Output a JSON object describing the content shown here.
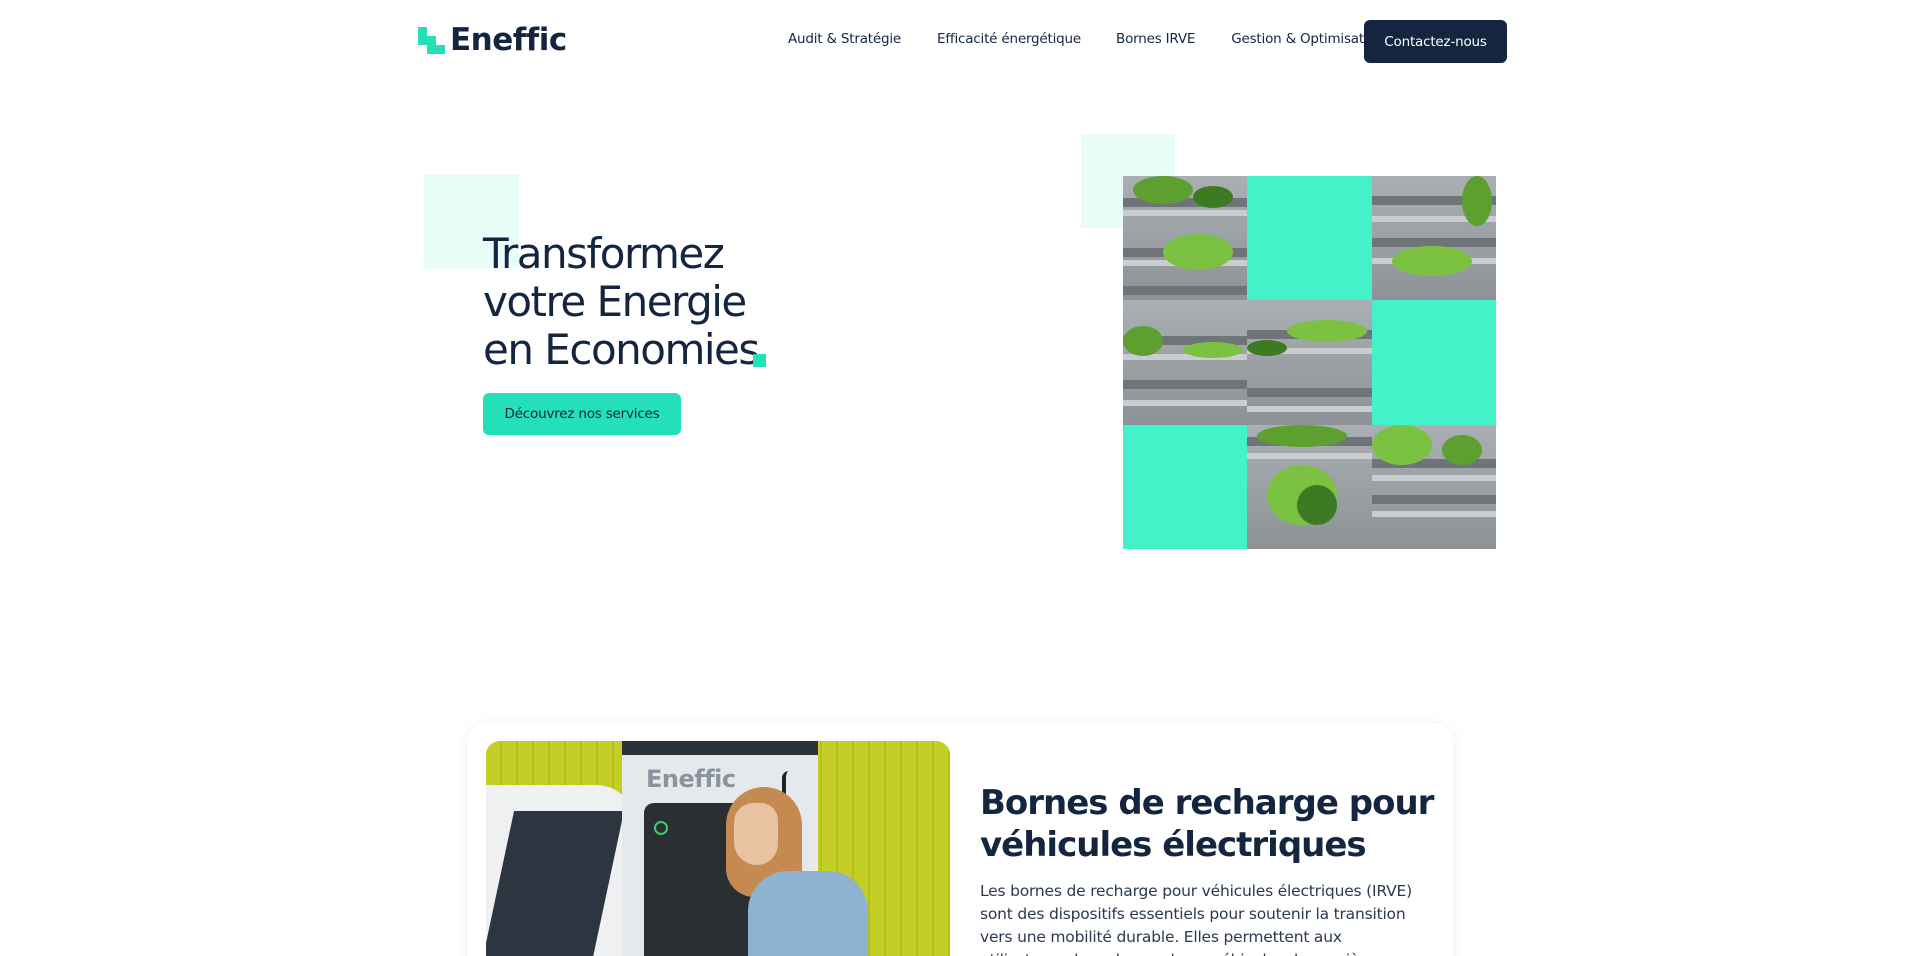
{
  "header": {
    "logo_text": "Eneffic",
    "nav": [
      {
        "label": "Audit & Stratégie"
      },
      {
        "label": "Efficacité énergétique"
      },
      {
        "label": "Bornes IRVE"
      },
      {
        "label": "Gestion & Optimisation"
      }
    ],
    "contact_label": "Contactez-nous"
  },
  "hero": {
    "title_lines": [
      "Transformez",
      "votre Energie",
      "en Economies"
    ],
    "cta_label": "Découvrez nos services",
    "mosaic_image": "green-building-photo"
  },
  "card": {
    "image": "ev-charger-photo",
    "image_logo_text": "Eneffic",
    "title_lines": [
      "Bornes de recharge pour",
      "véhicules électriques"
    ],
    "text": "Les bornes de recharge pour véhicules électriques (IRVE) sont des dispositifs essentiels pour soutenir la transition vers une mobilité durable. Elles permettent aux utilisateurs de recharger leurs véhicules de manière pratique et efficace."
  },
  "colors": {
    "brand_dark": "#14263f",
    "brand_accent": "#23e0b8",
    "accent_light": "#e8fdf7"
  }
}
